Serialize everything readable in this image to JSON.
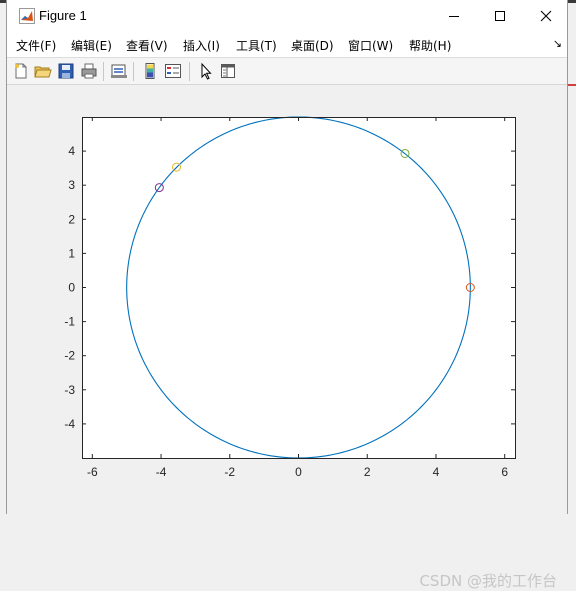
{
  "window": {
    "title": "Figure 1",
    "icon": "matlab-logo-icon"
  },
  "window_controls": [
    "minimize-icon",
    "maximize-icon",
    "close-icon"
  ],
  "menu": [
    {
      "label": "文件(F)"
    },
    {
      "label": "编辑(E)"
    },
    {
      "label": "查看(V)"
    },
    {
      "label": "插入(I)"
    },
    {
      "label": "工具(T)"
    },
    {
      "label": "桌面(D)"
    },
    {
      "label": "窗口(W)"
    },
    {
      "label": "帮助(H)"
    }
  ],
  "menu_overflow_icon": "dock-arrow-icon",
  "toolbar": [
    "new-figure-icon",
    "open-file-icon",
    "save-icon",
    "print-icon",
    "link-plot-icon",
    "insert-colorbar-icon",
    "insert-legend-icon",
    "edit-plot-icon",
    "property-inspector-icon"
  ],
  "chart_data": {
    "type": "line",
    "title": "",
    "xlabel": "",
    "ylabel": "",
    "xlim": [
      -6.3,
      6.3
    ],
    "ylim": [
      -5,
      5
    ],
    "xticks": [
      -6,
      -4,
      -2,
      0,
      2,
      4,
      6
    ],
    "yticks": [
      -4,
      -3,
      -2,
      -1,
      0,
      1,
      2,
      3,
      4
    ],
    "series": [
      {
        "kind": "line",
        "shape": "circle",
        "center": [
          0,
          0
        ],
        "radius": 5,
        "color": "#0072bd"
      },
      {
        "kind": "marker",
        "x": 5.0,
        "y": 0.0,
        "marker": "o",
        "color": "#d95319"
      },
      {
        "kind": "marker",
        "x": 3.1,
        "y": 3.93,
        "marker": "o",
        "color": "#77ac30"
      },
      {
        "kind": "marker",
        "x": -3.55,
        "y": 3.53,
        "marker": "o",
        "color": "#edb120"
      },
      {
        "kind": "marker",
        "x": -4.05,
        "y": 2.93,
        "marker": "o",
        "color": "#7e2f8e"
      }
    ],
    "grid": false
  },
  "watermark": "CSDN @我的工作台"
}
